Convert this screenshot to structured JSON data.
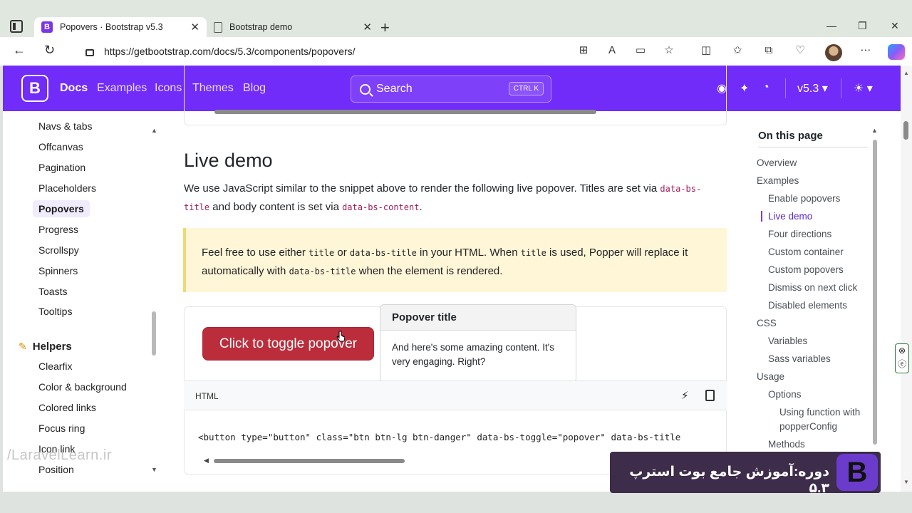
{
  "browser": {
    "tabs": [
      {
        "title": "Popovers · Bootstrap v5.3",
        "favicon": "B",
        "active": true
      },
      {
        "title": "Bootstrap demo",
        "active": false
      }
    ],
    "url": "https://getbootstrap.com/docs/5.3/components/popovers/"
  },
  "navbar": {
    "logo": "B",
    "links": [
      "Docs",
      "Examples",
      "Icons",
      "Themes",
      "Blog"
    ],
    "search_label": "Search",
    "search_shortcut": "CTRL K",
    "version": "v5.3",
    "brand_color": "#712cf9"
  },
  "sidebar": {
    "items": [
      "Navs & tabs",
      "Offcanvas",
      "Pagination",
      "Placeholders",
      "Popovers",
      "Progress",
      "Scrollspy",
      "Spinners",
      "Toasts",
      "Tooltips"
    ],
    "active": "Popovers",
    "helpers_heading": "Helpers",
    "helpers": [
      "Clearfix",
      "Color & background",
      "Colored links",
      "Focus ring",
      "Icon link",
      "Position"
    ]
  },
  "content": {
    "heading": "Live demo",
    "intro_1": "We use JavaScript similar to the snippet above to render the following live popover. Titles are set via ",
    "intro_code_1": "data-bs-title",
    "intro_2": " and body content is set via ",
    "intro_code_2": "data-bs-content",
    "intro_3": ".",
    "callout_1": "Feel free to use either ",
    "callout_code_1": "title",
    "callout_2": " or ",
    "callout_code_2": "data-bs-title",
    "callout_3": " in your HTML. When ",
    "callout_code_3": "title",
    "callout_4": " is used, Popper will replace it automatically with ",
    "callout_code_4": "data-bs-title",
    "callout_5": " when the element is rendered.",
    "demo_button": "Click to toggle popover",
    "popover_title": "Popover title",
    "popover_body": "And here's some amazing content. It's very engaging. Right?",
    "code_lang": "HTML",
    "code_line": "<button type=\"button\" class=\"btn btn-lg btn-danger\" data-bs-toggle=\"popover\" data-bs-title",
    "danger_color": "#bb2d3b"
  },
  "toc": {
    "title": "On this page",
    "items": [
      {
        "label": "Overview",
        "level": 1
      },
      {
        "label": "Examples",
        "level": 1
      },
      {
        "label": "Enable popovers",
        "level": 2
      },
      {
        "label": "Live demo",
        "level": 2,
        "active": true
      },
      {
        "label": "Four directions",
        "level": 2
      },
      {
        "label": "Custom container",
        "level": 2
      },
      {
        "label": "Custom popovers",
        "level": 2
      },
      {
        "label": "Dismiss on next click",
        "level": 2
      },
      {
        "label": "Disabled elements",
        "level": 2
      },
      {
        "label": "CSS",
        "level": 1
      },
      {
        "label": "Variables",
        "level": 2
      },
      {
        "label": "Sass variables",
        "level": 2
      },
      {
        "label": "Usage",
        "level": 1
      },
      {
        "label": "Options",
        "level": 2
      },
      {
        "label": "Using function with",
        "level": 3
      },
      {
        "label": "popperConfig",
        "level": 3
      },
      {
        "label": "Methods",
        "level": 2
      }
    ]
  },
  "overlay": {
    "watermark": "/LaravelLearn.ir",
    "banner_text": "دوره:آموزش جامع بوت استرپ ۵.۳",
    "banner_logo": "B"
  }
}
